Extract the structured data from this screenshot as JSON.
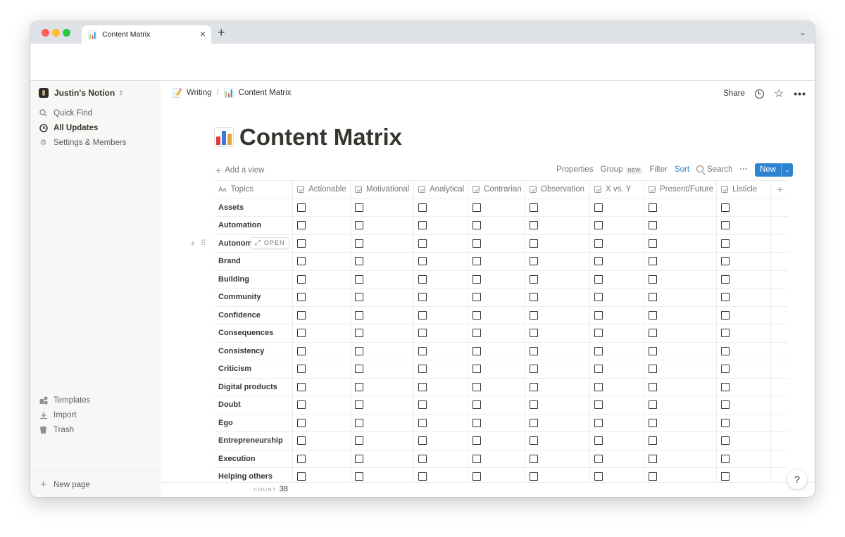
{
  "browser": {
    "tab_title": "Content Matrix",
    "tab_close": "×",
    "new_tab": "+",
    "tab_menu": "⌄"
  },
  "sidebar": {
    "workspace": "Justin's Notion",
    "workspace_chevron": "⌃⌄",
    "items": [
      {
        "label": "Quick Find",
        "icon": "search-icon"
      },
      {
        "label": "All Updates",
        "icon": "clock-icon"
      },
      {
        "label": "Settings & Members",
        "icon": "gear-icon"
      }
    ],
    "bottom_items": [
      {
        "label": "Templates",
        "icon": "templates-icon"
      },
      {
        "label": "Import",
        "icon": "download-icon"
      },
      {
        "label": "Trash",
        "icon": "trash-icon"
      }
    ],
    "new_page": "New page"
  },
  "header": {
    "breadcrumbs": [
      {
        "label": "Writing",
        "icon": "memo-emoji-icon"
      },
      {
        "label": "Content Matrix",
        "icon": "bar-chart-emoji-icon"
      }
    ],
    "separator": "/",
    "share": "Share"
  },
  "page": {
    "title": "Content Matrix",
    "icon": "bar-chart-emoji-icon"
  },
  "view_bar": {
    "add_view": "Add a view",
    "properties": "Properties",
    "group": "Group",
    "group_badge": "NEW",
    "filter": "Filter",
    "sort": "Sort",
    "search": "Search",
    "more": "···",
    "new_button": "New",
    "accent_color": "#2e83d1"
  },
  "table": {
    "title_column": "Topics",
    "columns": [
      "Actionable",
      "Motivational",
      "Analytical",
      "Contrarian",
      "Observation",
      "X vs. Y",
      "Present/Future",
      "Listicle"
    ],
    "rows": [
      {
        "topic": "Assets"
      },
      {
        "topic": "Automation"
      },
      {
        "topic": "Autonomy"
      },
      {
        "topic": "Brand"
      },
      {
        "topic": "Building"
      },
      {
        "topic": "Community"
      },
      {
        "topic": "Confidence"
      },
      {
        "topic": "Consequences"
      },
      {
        "topic": "Consistency"
      },
      {
        "topic": "Criticism"
      },
      {
        "topic": "Digital products"
      },
      {
        "topic": "Doubt"
      },
      {
        "topic": "Ego"
      },
      {
        "topic": "Entrepreneurship"
      },
      {
        "topic": "Execution"
      },
      {
        "topic": "Helping others"
      }
    ],
    "hover_row_index": 2,
    "open_button": "OPEN",
    "count_label": "COUNT",
    "count_value": "38"
  },
  "help": "?"
}
